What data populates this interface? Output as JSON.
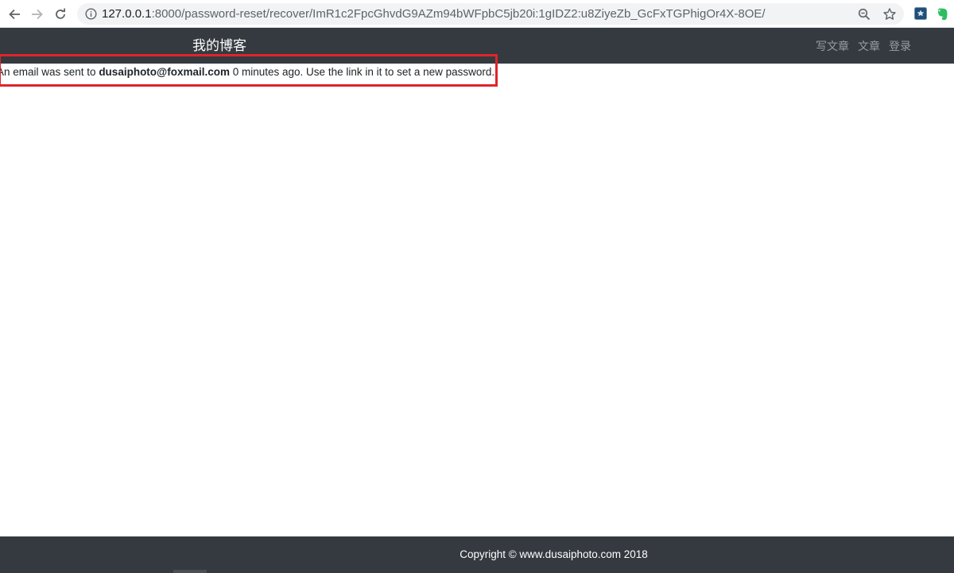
{
  "browser": {
    "url_host": "127.0.0.1",
    "url_rest": ":8000/password-reset/recover/ImR1c2FpcGhvdG9AZm94bWFpbC5jb20i:1gIDZ2:u8ZiyeZb_GcFxTGPhigOr4X-8OE/",
    "icons": [
      "back-arrow-icon",
      "forward-arrow-icon",
      "reload-icon",
      "info-icon",
      "zoom-icon",
      "bookmark-star-icon",
      "extension-icon",
      "evernote-icon"
    ]
  },
  "navbar": {
    "brand": "我的博客",
    "links": [
      "写文章",
      "文章",
      "登录"
    ]
  },
  "message": {
    "prefix": "An email was sent to ",
    "email": "dusaiphoto@foxmail.com",
    "suffix": " 0 minutes ago. Use the link in it to set a new password."
  },
  "footer": {
    "copyright": "Copyright © www.dusaiphoto.com 2018"
  },
  "colors": {
    "navbar_bg": "#343a40",
    "highlight_border": "#e0242a",
    "nav_link": "#9a9da0"
  }
}
